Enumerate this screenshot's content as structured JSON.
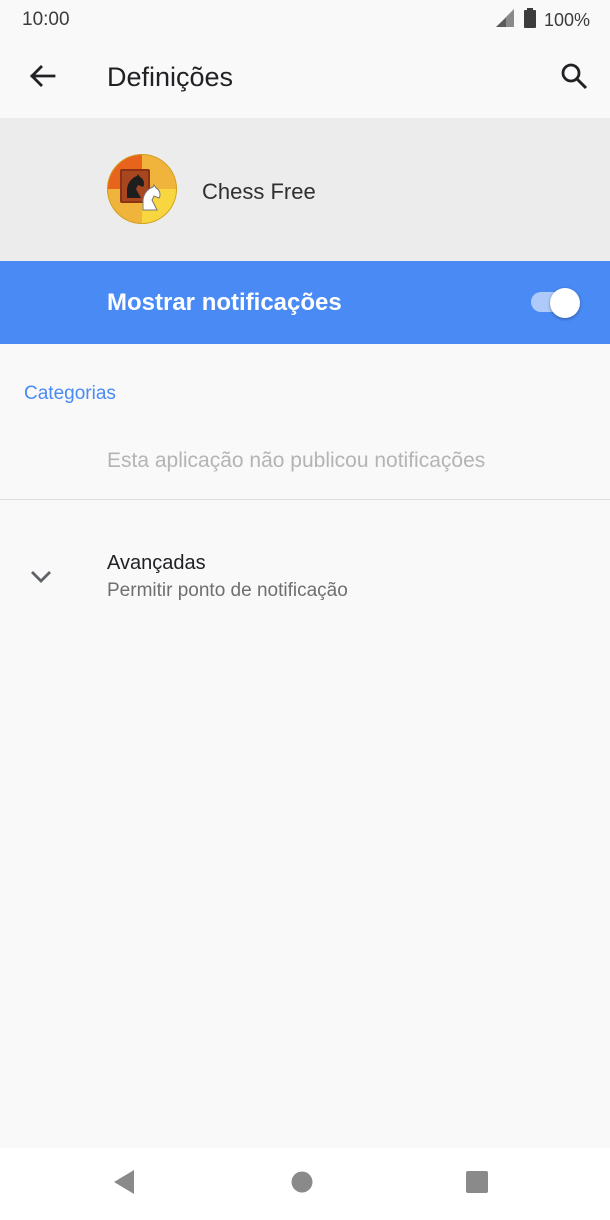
{
  "status_bar": {
    "time": "10:00",
    "battery_text": "100%",
    "icons": [
      "signal-icon",
      "battery-icon"
    ]
  },
  "app_bar": {
    "title": "Definições",
    "back_icon": "arrow-back-icon",
    "search_icon": "search-icon"
  },
  "app_header": {
    "app_name": "Chess Free",
    "app_icon": "chess-knight-icon"
  },
  "main_switch": {
    "label": "Mostrar notificações",
    "state": "on"
  },
  "categories": {
    "header": "Categorias",
    "empty_text": "Esta aplicação não publicou notificações"
  },
  "advanced": {
    "title": "Avançadas",
    "subtitle": "Permitir ponto de notificação",
    "icon": "chevron-down-icon"
  },
  "nav_bar": {
    "icons": [
      "nav-back-icon",
      "nav-home-icon",
      "nav-recents-icon"
    ]
  },
  "colors": {
    "accent": "#4a8af4",
    "background": "#f9f9f9",
    "header_bg": "#ececec"
  }
}
